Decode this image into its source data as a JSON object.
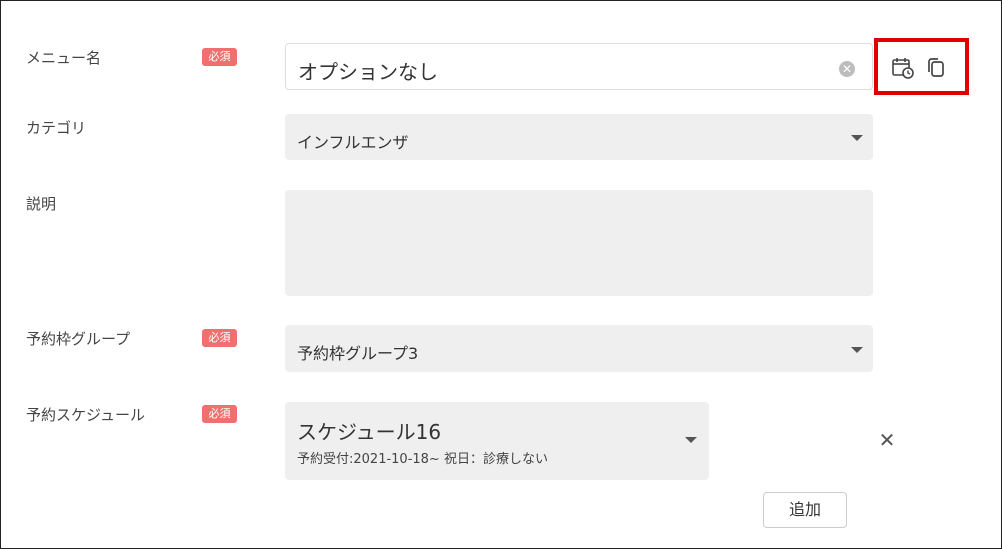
{
  "form": {
    "required_badge": "必須",
    "menu_name": {
      "label": "メニュー名",
      "value": "オプションなし",
      "clear_icon": "clear-circle-icon"
    },
    "category": {
      "label": "カテゴリ",
      "value": "インフルエンザ"
    },
    "description": {
      "label": "説明",
      "value": ""
    },
    "slot_group": {
      "label": "予約枠グループ",
      "value": "予約枠グループ3"
    },
    "schedule": {
      "label": "予約スケジュール",
      "value": "スケジュール16",
      "detail": "予約受付:2021-10-18~ 祝日：診療しない"
    },
    "add_button": "追加"
  },
  "toolbar": {
    "icons": [
      "calendar-clock-icon",
      "copy-icon"
    ],
    "highlight_color": "#e10000"
  },
  "colors": {
    "badge": "#f07070",
    "field_fill": "#efefef"
  }
}
